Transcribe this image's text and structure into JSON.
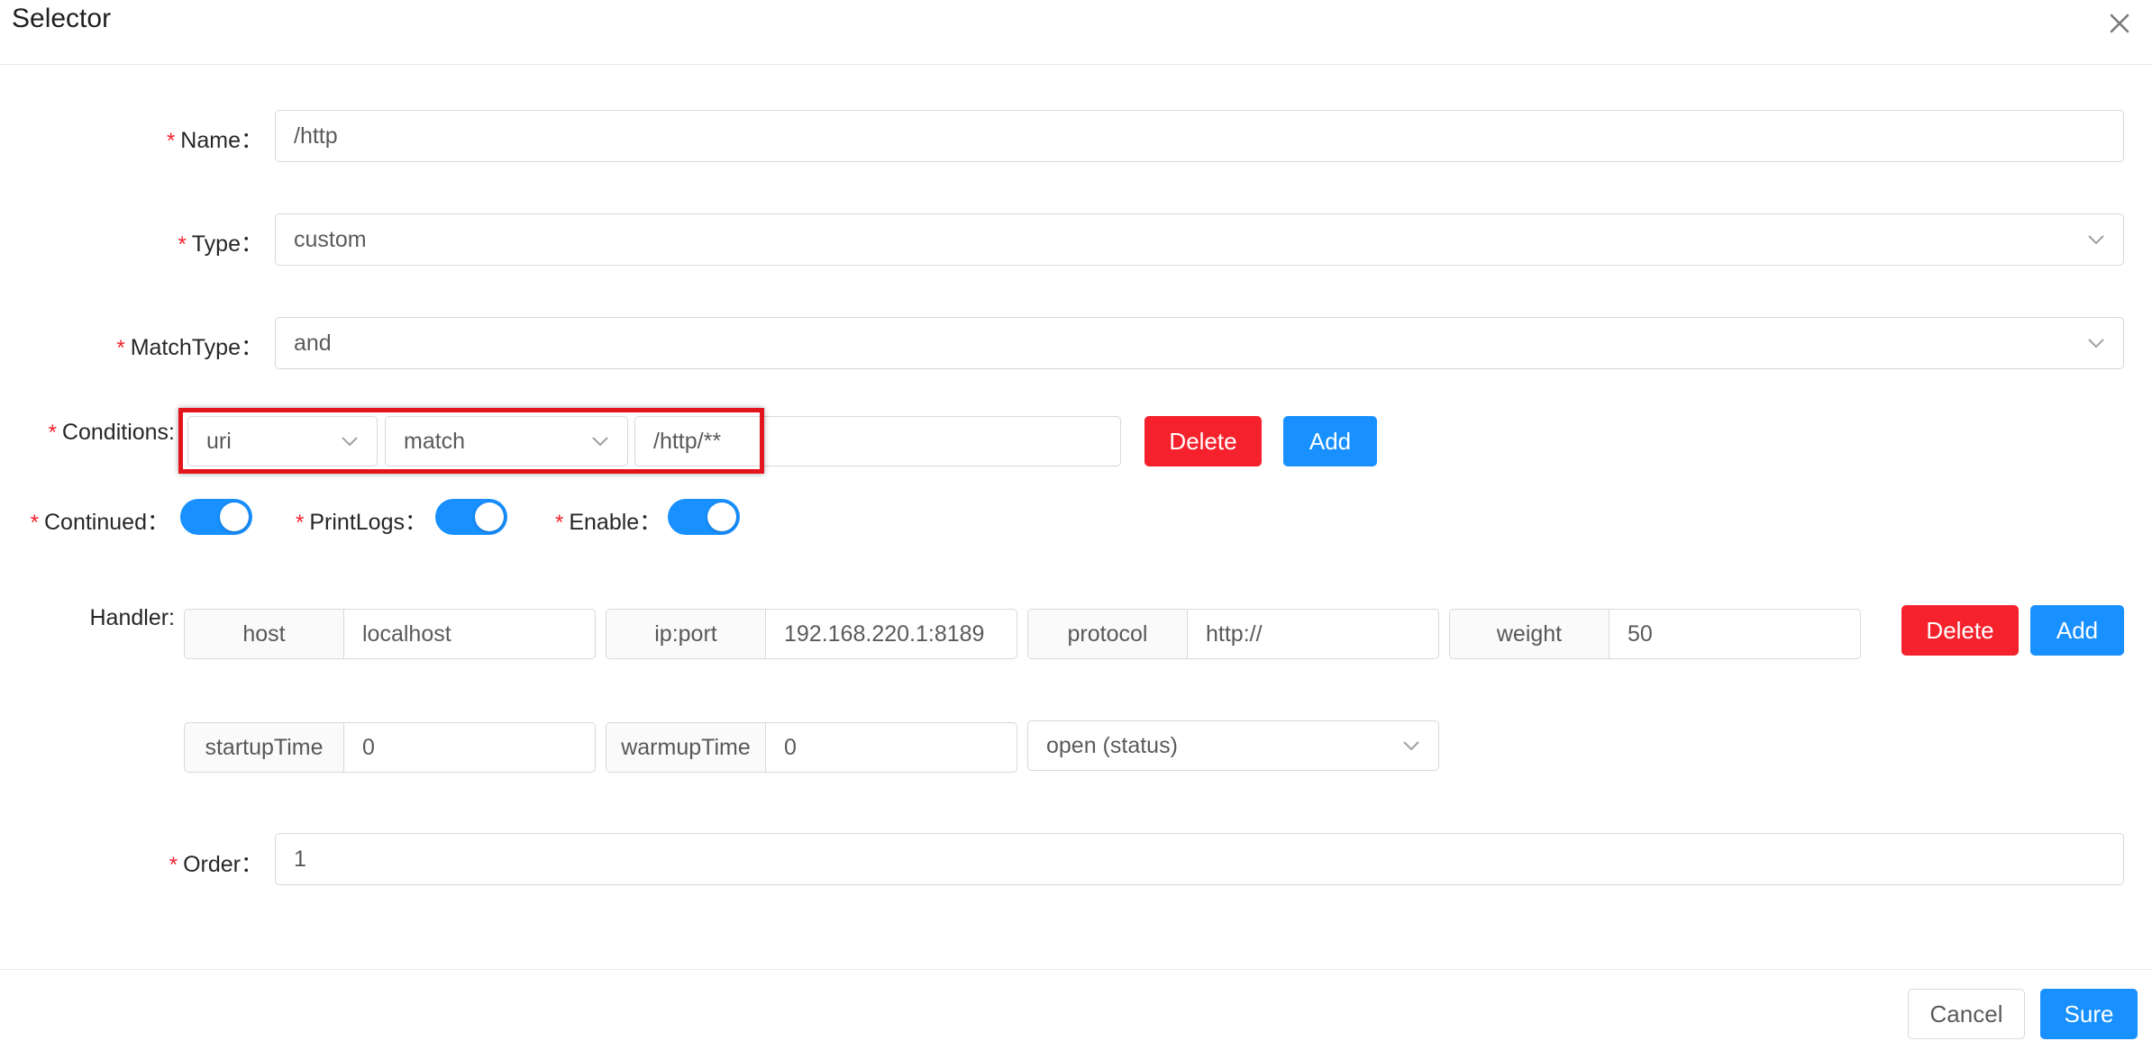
{
  "modal": {
    "title": "Selector"
  },
  "form": {
    "name": {
      "label": "Name",
      "value": "/http"
    },
    "type": {
      "label": "Type",
      "value": "custom"
    },
    "match_type": {
      "label": "MatchType",
      "value": "and"
    },
    "conditions": {
      "label": "Conditions:",
      "param_type": "uri",
      "operator": "match",
      "value": "/http/**",
      "delete_label": "Delete",
      "add_label": "Add"
    },
    "continued": {
      "label": "Continued",
      "on": true
    },
    "print_logs": {
      "label": "PrintLogs",
      "on": true
    },
    "enable": {
      "label": "Enable",
      "on": true
    },
    "handler": {
      "label": "Handler:",
      "host": {
        "label": "host",
        "value": "localhost"
      },
      "ip_port": {
        "label": "ip:port",
        "value": "192.168.220.1:8189"
      },
      "protocol": {
        "label": "protocol",
        "value": "http://"
      },
      "weight": {
        "label": "weight",
        "value": "50"
      },
      "startup_time": {
        "label": "startupTime",
        "value": "0"
      },
      "warmup_time": {
        "label": "warmupTime",
        "value": "0"
      },
      "status": {
        "value": "open (status)"
      },
      "delete_label": "Delete",
      "add_label": "Add"
    },
    "order": {
      "label": "Order",
      "value": "1"
    },
    "colon": "："
  },
  "footer": {
    "cancel_label": "Cancel",
    "sure_label": "Sure"
  },
  "colors": {
    "primary": "#1890ff",
    "danger": "#f5222d",
    "highlight_box": "#e3141b"
  }
}
